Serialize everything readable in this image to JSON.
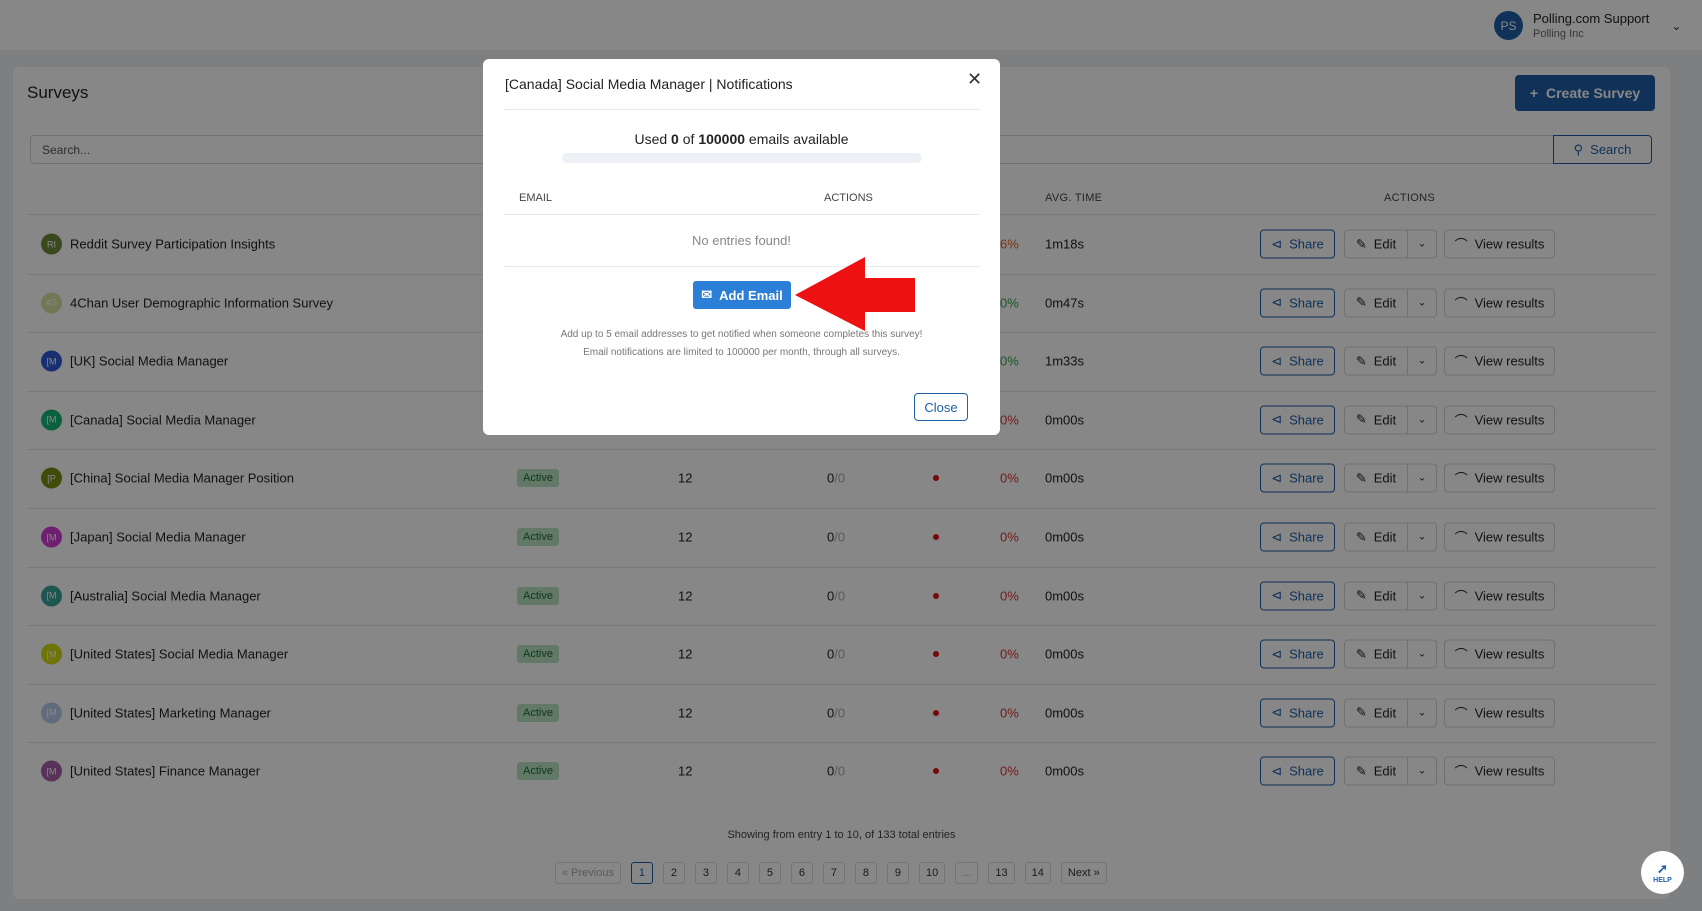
{
  "header": {
    "user_initials": "PS",
    "user_name": "Polling.com Support",
    "org": "Polling Inc"
  },
  "page": {
    "title": "Surveys",
    "create_label": "Create Survey",
    "search_placeholder": "Search...",
    "search_label": "Search"
  },
  "columns": {
    "avg_time": "AVG. TIME",
    "actions": "ACTIONS"
  },
  "actions": {
    "share": "Share",
    "edit": "Edit",
    "view": "View results"
  },
  "rows": [
    {
      "initials": "RI",
      "color": "#6e8a3a",
      "name": "Reddit Survey Participation Insights",
      "pct": "6%",
      "pct_color": "#e0661f",
      "avg": "1m18s"
    },
    {
      "initials": "4S",
      "color": "#d3e3a3",
      "name": "4Chan User Demographic Information Survey",
      "pct": "0%",
      "pct_color": "#2aa84a",
      "avg": "0m47s"
    },
    {
      "initials": "[M",
      "color": "#2f5bd8",
      "name": "[UK] Social Media Manager",
      "pct": "0%",
      "pct_color": "#2aa84a",
      "avg": "1m33s"
    },
    {
      "initials": "[M",
      "color": "#12b87a",
      "name": "[Canada] Social Media Manager",
      "pct": "0%",
      "pct_color": "#d33",
      "avg": "0m00s"
    },
    {
      "initials": "[P",
      "color": "#7d8c12",
      "name": "[China] Social Media Manager Position",
      "status": "Active",
      "questions": "12",
      "responses": "0",
      "responses_total": "/0",
      "pct": "0%",
      "avg": "0m00s"
    },
    {
      "initials": "[M",
      "color": "#d13ad6",
      "name": "[Japan] Social Media Manager",
      "status": "Active",
      "questions": "12",
      "responses": "0",
      "responses_total": "/0",
      "pct": "0%",
      "avg": "0m00s"
    },
    {
      "initials": "[M",
      "color": "#3aa59a",
      "name": "[Australia] Social Media Manager",
      "status": "Active",
      "questions": "12",
      "responses": "0",
      "responses_total": "/0",
      "pct": "0%",
      "avg": "0m00s"
    },
    {
      "initials": "[M",
      "color": "#d2dc10",
      "name": "[United States] Social Media Manager",
      "status": "Active",
      "questions": "12",
      "responses": "0",
      "responses_total": "/0",
      "pct": "0%",
      "avg": "0m00s"
    },
    {
      "initials": "[M",
      "color": "#b6cbe8",
      "name": "[United States] Marketing Manager",
      "status": "Active",
      "questions": "12",
      "responses": "0",
      "responses_total": "/0",
      "pct": "0%",
      "avg": "0m00s"
    },
    {
      "initials": "[M",
      "color": "#a65fa6",
      "name": "[United States] Finance Manager",
      "status": "Active",
      "questions": "12",
      "responses": "0",
      "responses_total": "/0",
      "pct": "0%",
      "avg": "0m00s"
    }
  ],
  "pagination": {
    "summary": "Showing from entry 1 to 10, of 133 total entries",
    "prev": "« Previous",
    "pages": [
      "1",
      "2",
      "3",
      "4",
      "5",
      "6",
      "7",
      "8",
      "9",
      "10",
      "...",
      "13",
      "14"
    ],
    "current": "1",
    "next": "Next »"
  },
  "help_label": "HELP",
  "modal": {
    "title": "[Canada] Social Media Manager | Notifications",
    "used_prefix": "Used ",
    "used": "0",
    "used_mid": " of ",
    "limit": "100000",
    "used_suffix": " emails available",
    "usage_fraction": 0,
    "col_email": "EMAIL",
    "col_actions": "ACTIONS",
    "empty": "No entries found!",
    "add_label": "Add Email",
    "help_line1": "Add up to 5 email addresses to get notified when someone completes this survey!",
    "help_line2": "Email notifications are limited to 100000 per month, through all surveys.",
    "close_label": "Close"
  },
  "colors": {
    "primary": "#1f5fa8",
    "add_button": "#2b7fd6",
    "arrow": "#ee1111"
  }
}
